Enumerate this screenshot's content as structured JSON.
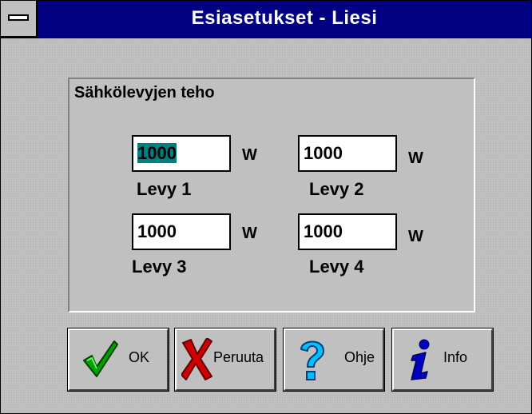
{
  "window": {
    "title": "Esiasetukset - Liesi"
  },
  "group": {
    "label": "Sähkölevyjen teho"
  },
  "plates": [
    {
      "value": "1000",
      "unit": "W",
      "label": "Levy 1"
    },
    {
      "value": "1000",
      "unit": "W",
      "label": "Levy 2"
    },
    {
      "value": "1000",
      "unit": "W",
      "label": "Levy 3"
    },
    {
      "value": "1000",
      "unit": "W",
      "label": "Levy 4"
    }
  ],
  "buttons": {
    "ok": {
      "label": "OK",
      "icon": "checkmark-icon"
    },
    "cancel": {
      "label": "Peruuta",
      "icon": "red-x-icon"
    },
    "help": {
      "label": "Ohje",
      "icon": "question-mark-icon"
    },
    "info": {
      "label": "Info",
      "icon": "info-icon"
    }
  },
  "colors": {
    "titlebar": "#000080",
    "face": "#c0c0c0",
    "selection": "#008080"
  }
}
